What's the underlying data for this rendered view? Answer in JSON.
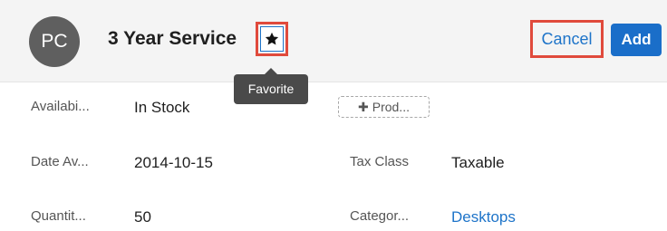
{
  "header": {
    "avatar_initials": "PC",
    "title": "3 Year Service",
    "favorite_icon": "star-icon",
    "favorite_tooltip": "Favorite",
    "cancel_label": "Cancel",
    "add_label": "Add"
  },
  "fields": {
    "availability": {
      "label": "Availabi...",
      "value": "In Stock"
    },
    "product_button": {
      "icon": "plus-icon",
      "label": "Prod..."
    },
    "date_available": {
      "label": "Date Av...",
      "value": "2014-10-15"
    },
    "tax_class": {
      "label": "Tax Class",
      "value": "Taxable"
    },
    "quantity": {
      "label": "Quantit...",
      "value": "50"
    },
    "category": {
      "label": "Categor...",
      "value": "Desktops"
    }
  },
  "colors": {
    "accent": "#1e74c9",
    "highlight": "#e04a3c",
    "header_bg": "#f4f4f4",
    "avatar_bg": "#5f5f5f",
    "tooltip_bg": "#4a4a4a"
  }
}
